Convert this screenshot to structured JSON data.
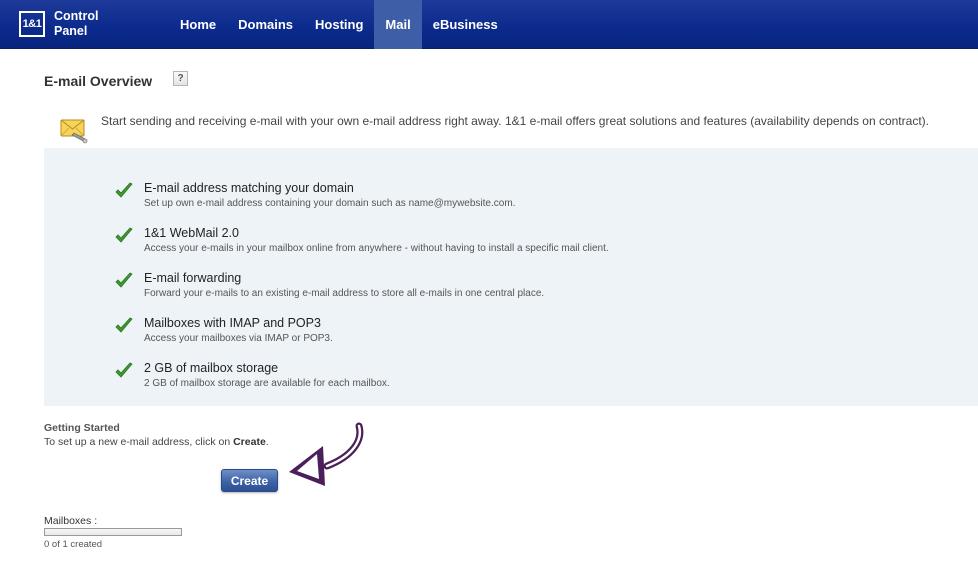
{
  "header": {
    "logo": "1&1",
    "app_name_line1": "Control",
    "app_name_line2": "Panel",
    "nav": [
      {
        "label": "Home"
      },
      {
        "label": "Domains"
      },
      {
        "label": "Hosting"
      },
      {
        "label": "Mail"
      },
      {
        "label": "eBusiness"
      }
    ],
    "active_tab": "Mail"
  },
  "page": {
    "title": "E-mail Overview",
    "help": "?",
    "intro": "Start sending and receiving e-mail with your own e-mail address right away. 1&1 e-mail offers great solutions and features (availability depends on contract)."
  },
  "features": [
    {
      "title": "E-mail address matching your domain",
      "desc": "Set up own e-mail address containing your domain such as name@mywebsite.com."
    },
    {
      "title": "1&1 WebMail 2.0",
      "desc": "Access your e-mails in your mailbox online from anywhere - without having to install a specific mail client."
    },
    {
      "title": "E-mail forwarding",
      "desc": "Forward your e-mails to an existing e-mail address to store all e-mails in one central place."
    },
    {
      "title": "Mailboxes with IMAP and POP3",
      "desc": "Access your mailboxes via IMAP or POP3."
    },
    {
      "title": "2 GB of mailbox storage",
      "desc": "2 GB of mailbox storage are available for each mailbox."
    }
  ],
  "getting_started": {
    "title": "Getting Started",
    "text_prefix": "To set up a new e-mail address, click on ",
    "text_strong": "Create",
    "text_suffix": "."
  },
  "create_button": "Create",
  "mailboxes": {
    "label": "Mailboxes :",
    "count": "0 of 1 created",
    "used_fraction": 0
  },
  "colors": {
    "nav_bg": "#0b2a8c",
    "nav_active": "#3f5ea8",
    "panel_bg": "#eef3f8",
    "check": "#3f9a2e",
    "arrow": "#4a1f5a",
    "button": "#3e63a8"
  }
}
